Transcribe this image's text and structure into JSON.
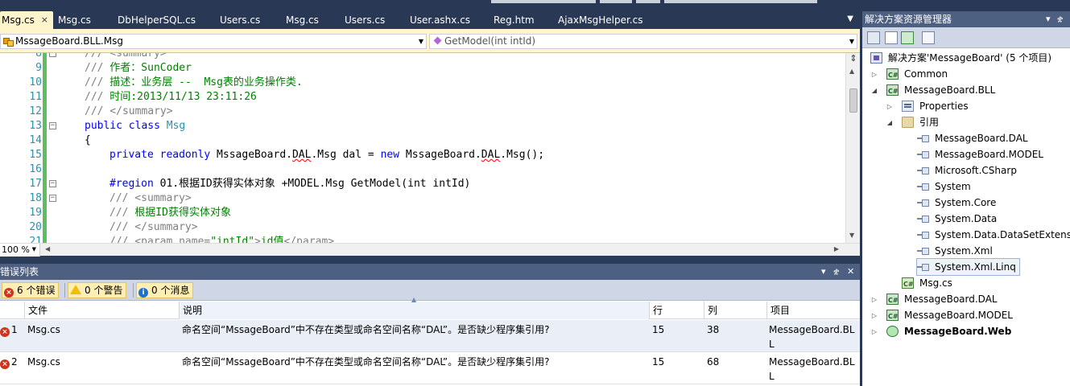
{
  "editor_tabs": [
    {
      "label": "Msg.cs",
      "active": true
    },
    {
      "label": "Msg.cs",
      "active": false
    },
    {
      "label": "DbHelperSQL.cs",
      "active": false
    },
    {
      "label": "Users.cs",
      "active": false
    },
    {
      "label": "Msg.cs",
      "active": false
    },
    {
      "label": "Users.cs",
      "active": false
    },
    {
      "label": "User.ashx.cs",
      "active": false
    },
    {
      "label": "Reg.htm",
      "active": false
    },
    {
      "label": "AjaxMsgHelper.cs",
      "active": false
    }
  ],
  "tab_close_glyph": "×",
  "navigation": {
    "type_combo": "MssageBoard.BLL.Msg",
    "member_combo": "GetModel(int intId)"
  },
  "code_lines": [
    {
      "no": "8",
      "text": "/// <summary>"
    },
    {
      "no": "9",
      "text": "/// 作者：SunCoder"
    },
    {
      "no": "10",
      "text": "/// 描述：业务层 --  Msg表的业务操作类."
    },
    {
      "no": "11",
      "text": "/// 时间:2013/11/13 23:11:26"
    },
    {
      "no": "12",
      "text": "/// </summary>"
    },
    {
      "no": "13",
      "text": "public class Msg"
    },
    {
      "no": "14",
      "text": "{"
    },
    {
      "no": "15",
      "text": "private readonly MssageBoard.DAL.Msg dal = new MssageBoard.DAL.Msg();"
    },
    {
      "no": "16",
      "text": ""
    },
    {
      "no": "17",
      "text": "#region 01.根据ID获得实体对象 +MODEL.Msg GetModel(int intId)"
    },
    {
      "no": "18",
      "text": "/// <summary>"
    },
    {
      "no": "19",
      "text": "/// 根据ID获得实体对象"
    },
    {
      "no": "20",
      "text": "/// </summary>"
    },
    {
      "no": "21",
      "text": "/// <param name=\"intId\">id值</param>"
    }
  ],
  "code_tokens": {
    "l8": {
      "doc": "/// <summary>"
    },
    "l9": {
      "doc": "///",
      "com": " 作者：SunCoder"
    },
    "l10": {
      "doc": "///",
      "com": " 描述：业务层 --  Msg表的业务操作类."
    },
    "l11": {
      "doc": "///",
      "com": " 时间:2013/11/13 23:11:26"
    },
    "l12": {
      "doc": "/// </summary>"
    },
    "l13": {
      "kw": "public class",
      "ty": "Msg"
    },
    "l14": {
      "plain": "{"
    },
    "l15": {
      "kw1": "private readonly",
      "p1": " MssageBoard.",
      "sq1": "DAL",
      "p2": ".Msg dal = ",
      "kw2": "new",
      "p3": " MssageBoard.",
      "sq2": "DAL",
      "p4": ".Msg();"
    },
    "l17": {
      "kw": "#region",
      "plain": " 01.根据ID获得实体对象 +MODEL.Msg GetModel(int intId)"
    },
    "l18": {
      "doc": "/// <summary>"
    },
    "l19": {
      "doc": "///",
      "com": " 根据ID获得实体对象"
    },
    "l20": {
      "doc": "/// </summary>"
    },
    "l21": {
      "doc1": "/// <param name=",
      "doc2": "\"intId\"",
      "doc3": ">",
      "com": "id值",
      "doc4": "</param>"
    }
  },
  "zoom": "100 %",
  "error_list": {
    "title": "错误列表",
    "filters": {
      "errors": "6 个错误",
      "warnings": "0 个警告",
      "messages": "0 个消息"
    },
    "columns": [
      "文件",
      "说明",
      "行",
      "列",
      "项目"
    ],
    "rows": [
      {
        "index": "1",
        "file": "Msg.cs",
        "description": "命名空间“MssageBoard”中不存在类型或命名空间名称“DAL”。是否缺少程序集引用?",
        "line": "15",
        "column": "38",
        "project_l1": "MessageBoard.BL",
        "project_l2": "L"
      },
      {
        "index": "2",
        "file": "Msg.cs",
        "description": "命名空间“MssageBoard”中不存在类型或命名空间名称“DAL”。是否缺少程序集引用?",
        "line": "15",
        "column": "68",
        "project_l1": "MessageBoard.BL",
        "project_l2": "L"
      }
    ]
  },
  "solution_explorer": {
    "title": "解决方案资源管理器",
    "nodes": [
      {
        "label": "解决方案'MessageBoard' (5 个项目)",
        "bold": false
      },
      {
        "label": "Common",
        "bold": false
      },
      {
        "label": "MessageBoard.BLL",
        "bold": false
      },
      {
        "label": "Properties",
        "bold": false
      },
      {
        "label": "引用",
        "bold": false
      },
      {
        "label": "MessageBoard.DAL",
        "bold": false
      },
      {
        "label": "MessageBoard.MODEL",
        "bold": false
      },
      {
        "label": "Microsoft.CSharp",
        "bold": false
      },
      {
        "label": "System",
        "bold": false
      },
      {
        "label": "System.Core",
        "bold": false
      },
      {
        "label": "System.Data",
        "bold": false
      },
      {
        "label": "System.Data.DataSetExtensio",
        "bold": false
      },
      {
        "label": "System.Xml",
        "bold": false
      },
      {
        "label": "System.Xml.Linq",
        "bold": false
      },
      {
        "label": "Msg.cs",
        "bold": false
      },
      {
        "label": "MessageBoard.DAL",
        "bold": false
      },
      {
        "label": "MessageBoard.MODEL",
        "bold": false
      },
      {
        "label": "MessageBoard.Web",
        "bold": true
      }
    ]
  },
  "colors": {
    "chrome": "#293955",
    "panel_title": "#4d6082",
    "active_tab": "#fff5cc",
    "comment": "#008000",
    "keyword": "#0000ff",
    "type": "#2b91af",
    "error": "#d1321b"
  }
}
